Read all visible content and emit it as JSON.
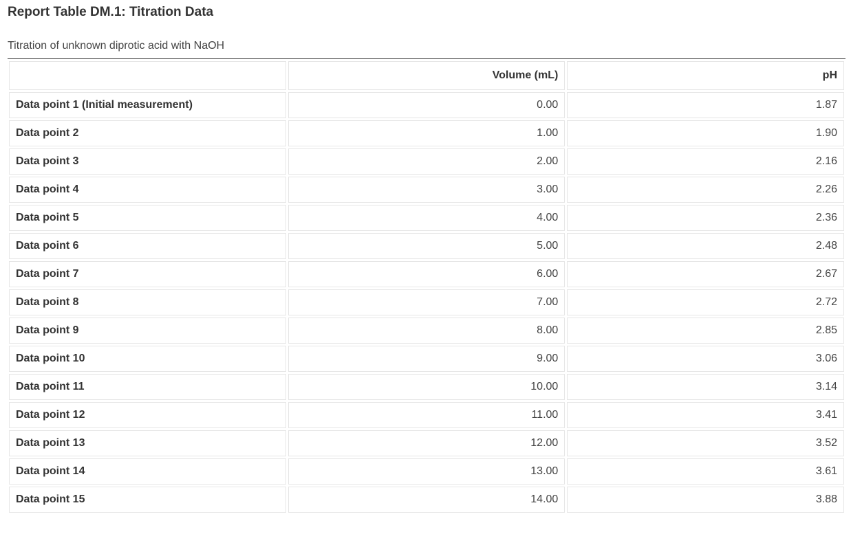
{
  "title": "Report Table DM.1: Titration Data",
  "caption": "Titration of unknown diprotic acid with NaOH",
  "table": {
    "columns": [
      "",
      "Volume (mL)",
      "pH"
    ],
    "rows": [
      {
        "label": "Data point 1 (Initial measurement)",
        "volume": "0.00",
        "ph": "1.87"
      },
      {
        "label": "Data point 2",
        "volume": "1.00",
        "ph": "1.90"
      },
      {
        "label": "Data point 3",
        "volume": "2.00",
        "ph": "2.16"
      },
      {
        "label": "Data point 4",
        "volume": "3.00",
        "ph": "2.26"
      },
      {
        "label": "Data point 5",
        "volume": "4.00",
        "ph": "2.36"
      },
      {
        "label": "Data point 6",
        "volume": "5.00",
        "ph": "2.48"
      },
      {
        "label": "Data point 7",
        "volume": "6.00",
        "ph": "2.67"
      },
      {
        "label": "Data point 8",
        "volume": "7.00",
        "ph": "2.72"
      },
      {
        "label": "Data point 9",
        "volume": "8.00",
        "ph": "2.85"
      },
      {
        "label": "Data point 10",
        "volume": "9.00",
        "ph": "3.06"
      },
      {
        "label": "Data point 11",
        "volume": "10.00",
        "ph": "3.14"
      },
      {
        "label": "Data point 12",
        "volume": "11.00",
        "ph": "3.41"
      },
      {
        "label": "Data point 13",
        "volume": "12.00",
        "ph": "3.52"
      },
      {
        "label": "Data point 14",
        "volume": "13.00",
        "ph": "3.61"
      },
      {
        "label": "Data point 15",
        "volume": "14.00",
        "ph": "3.88"
      }
    ]
  }
}
